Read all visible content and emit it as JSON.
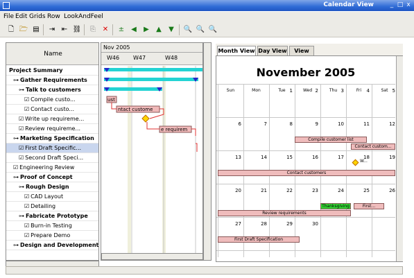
{
  "window": {
    "title": "Calendar View",
    "controls": [
      "_",
      "□",
      "x"
    ]
  },
  "menu": [
    "File",
    "Edit",
    "Grids",
    "Row",
    "LookAndFeel"
  ],
  "toolbar": {
    "icons": [
      "new-icon",
      "open-icon",
      "save-icon",
      "indent-icon",
      "outdent-icon",
      "link-icon",
      "paste-icon",
      "delete-icon",
      "add-task-icon",
      "left-arrow-icon",
      "right-arrow-icon",
      "up-arrow-icon",
      "down-arrow-icon",
      "zoom-icon",
      "zoom-in-icon",
      "zoom-out-icon"
    ]
  },
  "tree": {
    "header": "Name",
    "rows": [
      {
        "label": "Project Summary",
        "level": 0,
        "bold": true,
        "icon": ""
      },
      {
        "label": "Gather Requirements",
        "level": 1,
        "bold": true,
        "icon": "⊶"
      },
      {
        "label": "Talk to customers",
        "level": 2,
        "bold": true,
        "icon": "⊶"
      },
      {
        "label": "Compile custo...",
        "level": 3,
        "bold": false,
        "icon": "☑"
      },
      {
        "label": "Contact custo...",
        "level": 3,
        "bold": false,
        "icon": "☑"
      },
      {
        "label": "Write up requireme...",
        "level": 2,
        "bold": false,
        "icon": "☑"
      },
      {
        "label": "Review requireme...",
        "level": 2,
        "bold": false,
        "icon": "☑"
      },
      {
        "label": "Marketing Specification",
        "level": 1,
        "bold": true,
        "icon": "⊶"
      },
      {
        "label": "First Draft Specific...",
        "level": 2,
        "bold": false,
        "icon": "☑",
        "selected": true
      },
      {
        "label": "Second Draft Speci...",
        "level": 2,
        "bold": false,
        "icon": "☑"
      },
      {
        "label": "Engineering Review",
        "level": 1,
        "bold": false,
        "icon": "☑"
      },
      {
        "label": "Proof of Concept",
        "level": 1,
        "bold": true,
        "icon": "⊶"
      },
      {
        "label": "Rough Design",
        "level": 2,
        "bold": true,
        "icon": "⊶"
      },
      {
        "label": "CAD Layout",
        "level": 3,
        "bold": false,
        "icon": "☑"
      },
      {
        "label": "Detailing",
        "level": 3,
        "bold": false,
        "icon": "☑"
      },
      {
        "label": "Fabricate Prototype",
        "level": 2,
        "bold": true,
        "icon": "⊶"
      },
      {
        "label": "Burn-in Testing",
        "level": 3,
        "bold": false,
        "icon": "☑"
      },
      {
        "label": "Prepare Demo",
        "level": 3,
        "bold": false,
        "icon": "☑"
      },
      {
        "label": "Design and Development",
        "level": 1,
        "bold": true,
        "icon": "⊶"
      }
    ]
  },
  "gantt": {
    "month": "Nov 2005",
    "weeks": [
      "W46",
      "W47",
      "W48"
    ],
    "labels": [
      "ust",
      "ntact custome",
      "e requirem"
    ]
  },
  "calendar": {
    "tabs": [
      "Month View",
      "Day View",
      "View"
    ],
    "heading": "November 2005",
    "days": [
      "Sun",
      "Mon",
      "Tue",
      "Wed",
      "Thu",
      "Fri",
      "Sat"
    ],
    "dates": [
      [
        "",
        "",
        "1",
        "2",
        "3",
        "4",
        "5"
      ],
      [
        "6",
        "7",
        "8",
        "9",
        "10",
        "11",
        "12"
      ],
      [
        "13",
        "14",
        "15",
        "16",
        "17",
        "18",
        "19"
      ],
      [
        "20",
        "21",
        "22",
        "23",
        "24",
        "25",
        "26"
      ],
      [
        "27",
        "28",
        "29",
        "30",
        "",
        "",
        ""
      ]
    ],
    "events": {
      "compile": "Compile customer list",
      "contact_short": "Contact custom...",
      "w_label": "W...",
      "contact": "Contact customers",
      "thanksgiving": "Thanksgiving",
      "first_short": "First...",
      "review": "Review requirements",
      "first_draft": "First Draft Specification"
    }
  },
  "colors": {
    "gantt_bar": "#24d3d3",
    "summary": "#2626c8",
    "task": "#f0b9b9",
    "milestone": "#ffd700",
    "link": "#e03030",
    "thanksgiving": "#33d633"
  }
}
